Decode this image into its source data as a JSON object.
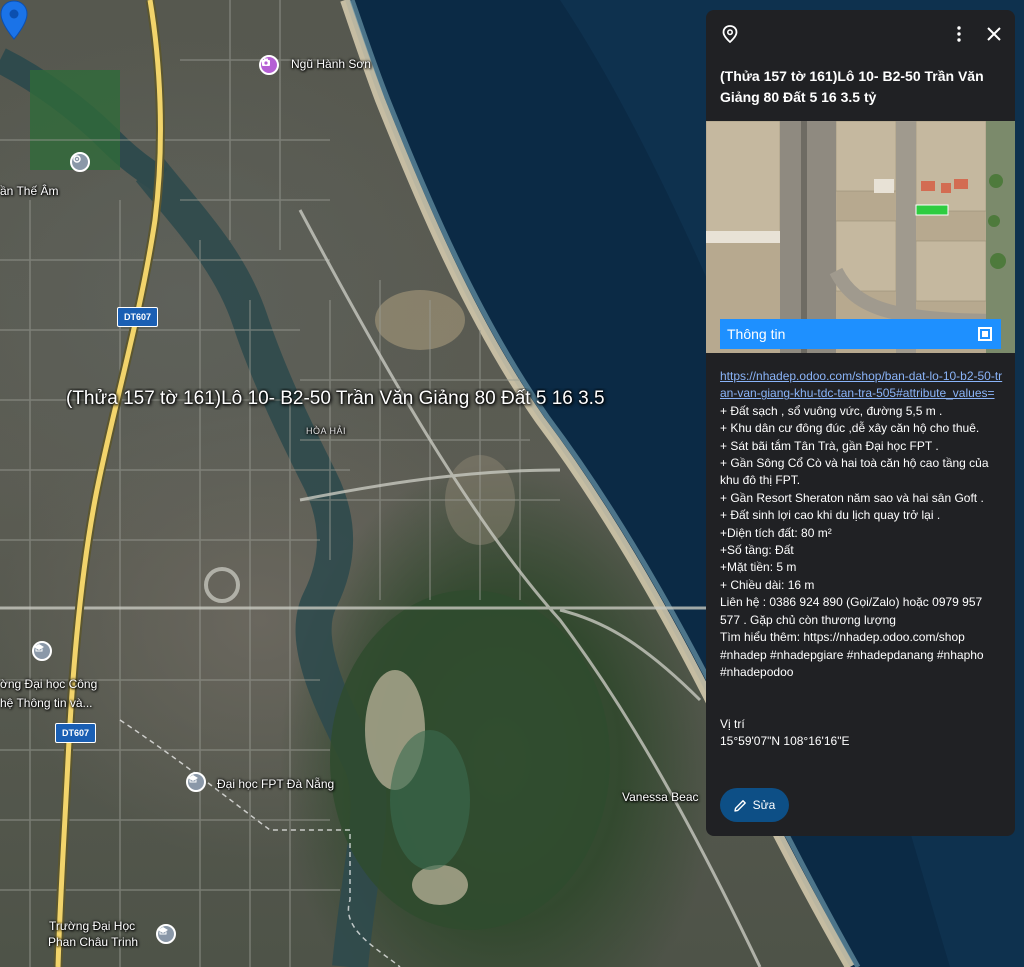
{
  "map": {
    "selected_place_label": "(Thửa 157 tờ 161)Lô 10- B2-50 Trần Văn Giảng  80 Đất 5 16 3.5",
    "labels": {
      "ngu_hanh_son": "Ngũ Hành Sơn",
      "than_the_am": "ần Thế Âm",
      "hoa_hai": "HÒA HẢI",
      "dai_hoc_cong_nghe_line1": "ờng Đại học Công",
      "dai_hoc_cong_nghe_line2": "hệ Thông tin và...",
      "dai_hoc_fpt": "Đại học FPT Đà Nẵng",
      "vanessa_beach": "Vanessa Beac",
      "phan_chau_trinh_line1": "Trường Đại Học",
      "phan_chau_trinh_line2": "Phan Châu Trinh"
    },
    "route_badges": [
      "DT607",
      "DT607"
    ],
    "colors": {
      "pin": "#1a73e8",
      "sea": "#0b2a45",
      "road_main": "#f2d46b"
    }
  },
  "panel": {
    "title": "(Thửa 157 tờ 161)Lô 10- B2-50 Trần Văn Giảng  80 Đất 5 16 3.5 tỷ",
    "image_caption": "Thông tin",
    "link": "https://nhadep.odoo.com/shop/ban-dat-lo-10-b2-50-tran-van-giang-khu-tdc-tan-tra-505#attribute_values=",
    "lines": [
      "+ Đất sạch , sổ vuông vức, đường 5,5 m .",
      "+ Khu dân cư đông đúc ,dễ xây căn hộ cho thuê.",
      "+ Sát bãi tắm Tân Trà, gần Đại học FPT .",
      "+ Gần Sông Cổ Cò và hai toà căn hộ cao tầng của khu đô thị FPT.",
      "+ Gần Resort Sheraton năm sao và hai sân Goft .",
      "+ Đất sinh lợi cao khi du lịch quay trở lại .",
      "+Diện tích đất: 80 m²",
      "+Số tầng: Đất",
      "+Mặt tiền: 5 m",
      "+ Chiều dài: 16 m",
      "Liên hệ : 0386 924 890 (Gọi/Zalo) hoặc 0979 957 577 . Gặp chủ còn thương lượng",
      "Tìm hiểu thêm: https://nhadep.odoo.com/shop",
      "#nhadep #nhadepgiare #nhadepdanang #nhapho #nhadepodoo"
    ],
    "location_label": "Vị trí",
    "coordinates": "15°59'07\"N 108°16'16\"E",
    "edit_label": "Sửa",
    "colors": {
      "background": "#202124",
      "link": "#8ab4f8",
      "caption_bg": "#1e90ff",
      "edit_bg": "#0d4f86"
    }
  }
}
